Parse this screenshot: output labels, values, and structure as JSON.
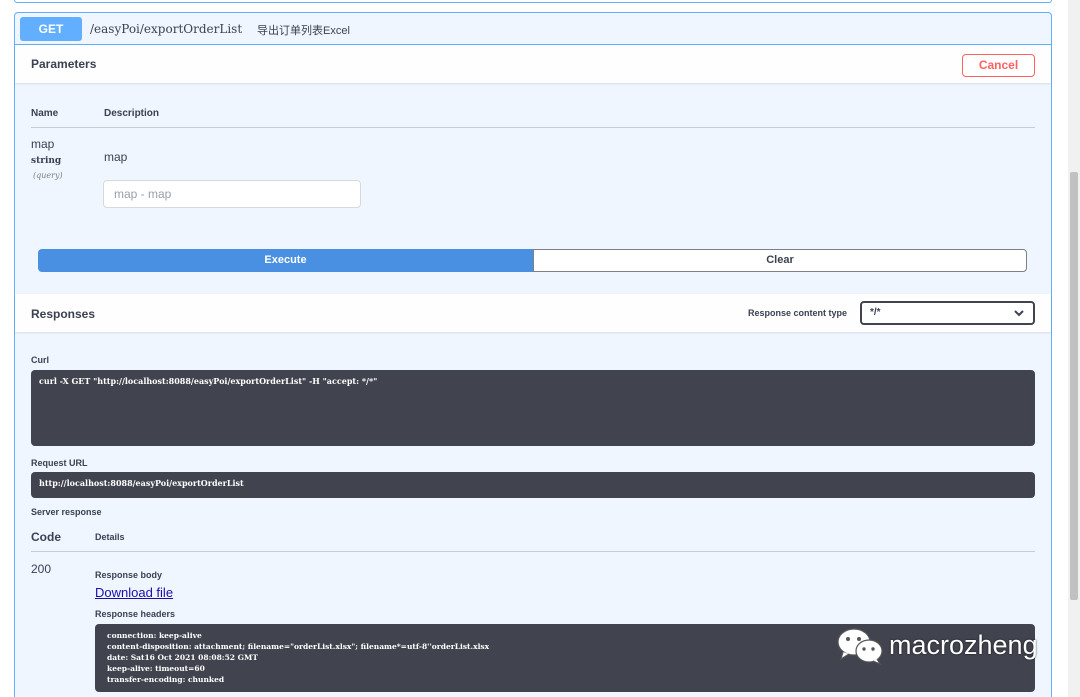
{
  "operation": {
    "method": "GET",
    "path": "/easyPoi/exportOrderList",
    "summary": "导出订单列表Excel"
  },
  "parameters": {
    "title": "Parameters",
    "cancel_label": "Cancel",
    "col_name": "Name",
    "col_description": "Description",
    "items": [
      {
        "name": "map",
        "type": "string",
        "in": "(query)",
        "description": "map",
        "placeholder": "map - map"
      }
    ]
  },
  "actions": {
    "execute_label": "Execute",
    "clear_label": "Clear"
  },
  "responses": {
    "title": "Responses",
    "content_type_label": "Response content type",
    "content_type_value": "*/*",
    "curl_label": "Curl",
    "curl_command": "curl -X GET \"http://localhost:8088/easyPoi/exportOrderList\" -H \"accept: */*\"",
    "request_url_label": "Request URL",
    "request_url": "http://localhost:8088/easyPoi/exportOrderList",
    "server_response_label": "Server response",
    "code_header": "Code",
    "details_header": "Details",
    "code": "200",
    "response_body_label": "Response body",
    "download_label": "Download file",
    "response_headers_label": "Response headers",
    "headers": [
      "connection: keep-alive",
      "content-disposition: attachment; filename=\"orderList.xlsx\"; filename*=utf-8''orderList.xlsx",
      "date: Sat16 Oct 2021 08:08:52 GMT",
      "keep-alive: timeout=60",
      "transfer-encoding: chunked"
    ]
  },
  "watermark": {
    "text": "macrozheng",
    "icon": "wechat-icon"
  },
  "colors": {
    "get_blue": "#61affe",
    "execute_blue": "#4990e2",
    "cancel_red": "#ff6060",
    "code_bg": "#41444e"
  }
}
